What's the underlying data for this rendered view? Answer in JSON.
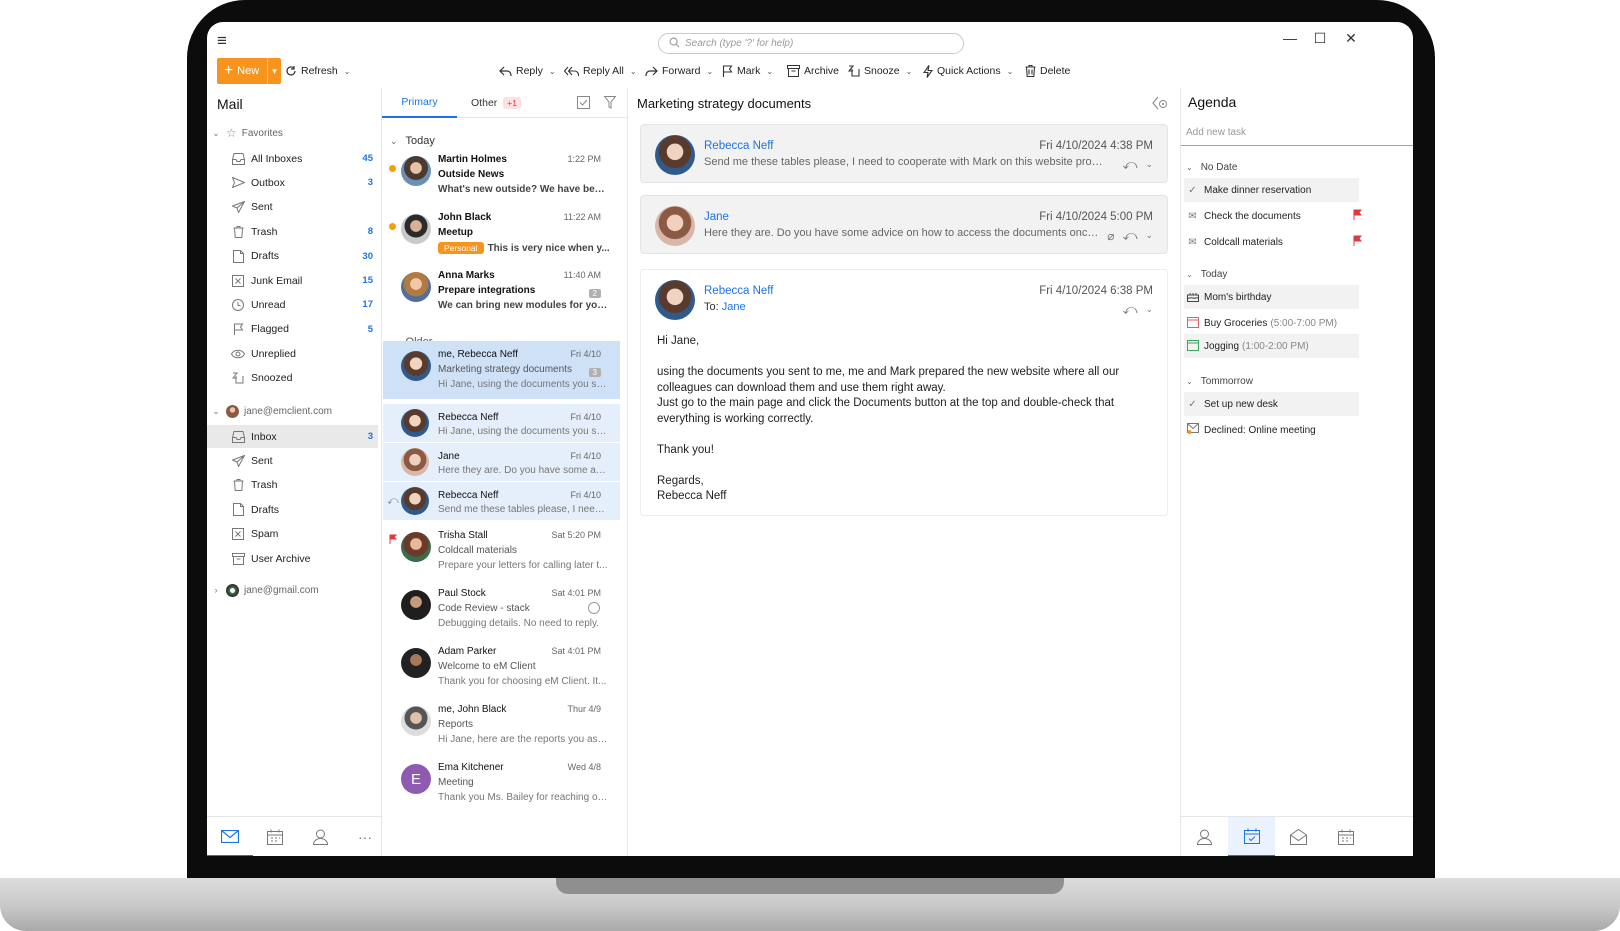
{
  "titlebar": {
    "search_placeholder": "Search (type '?' for help)"
  },
  "toolbar": {
    "new": "New",
    "refresh": "Refresh",
    "reply": "Reply",
    "reply_all": "Reply All",
    "forward": "Forward",
    "mark": "Mark",
    "archive": "Archive",
    "snooze": "Snooze",
    "quick_actions": "Quick Actions",
    "delete": "Delete"
  },
  "folders": {
    "title": "Mail",
    "favorites": "Favorites",
    "fav_items": [
      {
        "label": "All Inboxes",
        "count": "45"
      },
      {
        "label": "Outbox",
        "count": "3"
      },
      {
        "label": "Sent",
        "count": ""
      },
      {
        "label": "Trash",
        "count": "8"
      },
      {
        "label": "Drafts",
        "count": "30"
      },
      {
        "label": "Junk Email",
        "count": "15"
      },
      {
        "label": "Unread",
        "count": "17"
      },
      {
        "label": "Flagged",
        "count": "5"
      },
      {
        "label": "Unreplied",
        "count": ""
      },
      {
        "label": "Snoozed",
        "count": ""
      }
    ],
    "account1": "jane@emclient.com",
    "acct_items": [
      {
        "label": "Inbox",
        "count": "3"
      },
      {
        "label": "Sent",
        "count": ""
      },
      {
        "label": "Trash",
        "count": ""
      },
      {
        "label": "Drafts",
        "count": ""
      },
      {
        "label": "Spam",
        "count": ""
      },
      {
        "label": "User Archive",
        "count": ""
      }
    ],
    "account2": "jane@gmail.com"
  },
  "list": {
    "tab_primary": "Primary",
    "tab_other": "Other",
    "other_badge": "+1",
    "group_today": "Today",
    "group_older": "Older",
    "messages": [
      {
        "from": "Martin Holmes",
        "time": "1:22 PM",
        "subject": "Outside News",
        "preview": "What's new outside? We have been..."
      },
      {
        "from": "John Black",
        "time": "11:22 AM",
        "subject": "Meetup",
        "tag": "Personal",
        "preview": "This is very nice when y..."
      },
      {
        "from": "Anna Marks",
        "time": "11:40 AM",
        "subject": "Prepare integrations",
        "badge": "2",
        "preview": "We can bring new modules for you..."
      },
      {
        "from": "me, Rebecca Neff",
        "time": "Fri 4/10",
        "subject": "Marketing strategy documents",
        "badge": "3",
        "preview": "Hi Jane, using the documents you se..."
      },
      {
        "from": "Rebecca Neff",
        "time": "Fri 4/10",
        "subject": "",
        "preview": "Hi Jane, using the documents you se..."
      },
      {
        "from": "Jane",
        "time": "Fri 4/10",
        "subject": "",
        "preview": "Here they are. Do you have some adv..."
      },
      {
        "from": "Rebecca Neff",
        "time": "Fri 4/10",
        "subject": "",
        "preview": "Send me these tables please, I need t..."
      },
      {
        "from": "Trisha Stall",
        "time": "Sat 5:20 PM",
        "subject": "Coldcall materials",
        "preview": "Prepare your letters for calling later t..."
      },
      {
        "from": "Paul Stock",
        "time": "Sat 4:01 PM",
        "subject": "Code Review - stack",
        "preview": "Debugging details. No need to reply."
      },
      {
        "from": "Adam Parker",
        "time": "Sat 4:01 PM",
        "subject": "Welcome to eM Client",
        "preview": "Thank you for choosing eM Client. It..."
      },
      {
        "from": "me, John Black",
        "time": "Thur 4/9",
        "subject": "Reports",
        "preview": "Hi Jane, here are the reports you ask..."
      },
      {
        "from": "Ema Kitchener",
        "time": "Wed 4/8",
        "subject": "Meeting",
        "initial": "E",
        "preview": "Thank you Ms. Bailey for reaching ou..."
      }
    ]
  },
  "reader": {
    "title": "Marketing strategy documents",
    "cards": [
      {
        "name": "Rebecca Neff",
        "date": "Fri 4/10/2024 4:38 PM",
        "preview": "Send me these tables please, I need to cooperate with Mark on this website project..."
      },
      {
        "name": "Jane",
        "date": "Fri 4/10/2024 5:00 PM",
        "preview": "Here they are. Do you have some advice on how to access the documents once th..."
      },
      {
        "name": "Rebecca Neff",
        "date": "Fri 4/10/2024 6:38 PM",
        "to_label": "To:",
        "to": "Jane"
      }
    ],
    "body": {
      "greeting": "Hi Jane,",
      "p1": "using the documents you sent to me, me and Mark prepared the new website where all our colleagues can download them and use them right away.",
      "p2": "Just go to the main page and click the Documents button at the top and double-check that everything is working correctly.",
      "p3": "Thank you!",
      "p4a": "Regards,",
      "p4b": "Rebecca Neff"
    }
  },
  "agenda": {
    "title": "Agenda",
    "add_placeholder": "Add new task",
    "no_date": "No Date",
    "today": "Today",
    "tomorrow": "Tommorrow",
    "items": {
      "dinner": "Make dinner reservation",
      "docs": "Check the documents",
      "coldcall": "Coldcall materials",
      "birthday": "Mom's birthday",
      "groceries": "Buy Groceries",
      "groceries_time": "(5:00-7:00 PM)",
      "jogging": "Jogging",
      "jogging_time": "(1:00-2:00 PM)",
      "desk": "Set up new desk",
      "declined": "Declined: Online meeting"
    }
  },
  "colors": {
    "accent": "#1a73e8",
    "orange": "#f7941d",
    "flag": "#e0383e"
  }
}
